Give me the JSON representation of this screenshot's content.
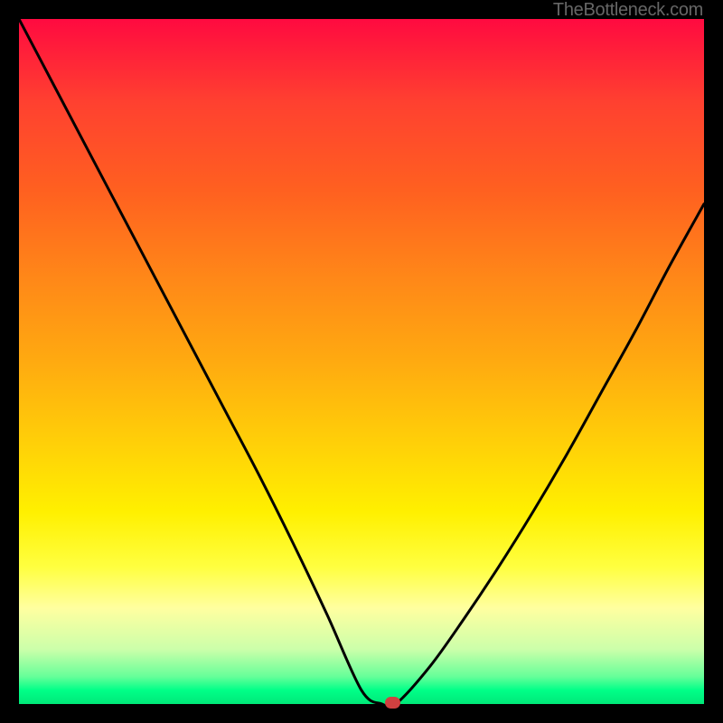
{
  "watermark": "TheBottleneck.com",
  "chart_data": {
    "type": "line",
    "title": "",
    "xlabel": "",
    "ylabel": "",
    "x": [
      0.0,
      0.05,
      0.1,
      0.15,
      0.2,
      0.25,
      0.3,
      0.35,
      0.4,
      0.45,
      0.5,
      0.53,
      0.55,
      0.6,
      0.65,
      0.7,
      0.75,
      0.8,
      0.85,
      0.9,
      0.95,
      1.0
    ],
    "values": [
      1.0,
      0.905,
      0.81,
      0.715,
      0.62,
      0.525,
      0.43,
      0.335,
      0.235,
      0.13,
      0.02,
      0.0,
      0.0,
      0.055,
      0.125,
      0.2,
      0.28,
      0.365,
      0.455,
      0.545,
      0.64,
      0.73
    ],
    "ylim": [
      0,
      1
    ],
    "xlim": [
      0,
      1
    ],
    "marker": {
      "x": 0.545,
      "y": 0.0
    },
    "background": "red-yellow-green vertical gradient (bottleneck heatmap)"
  }
}
